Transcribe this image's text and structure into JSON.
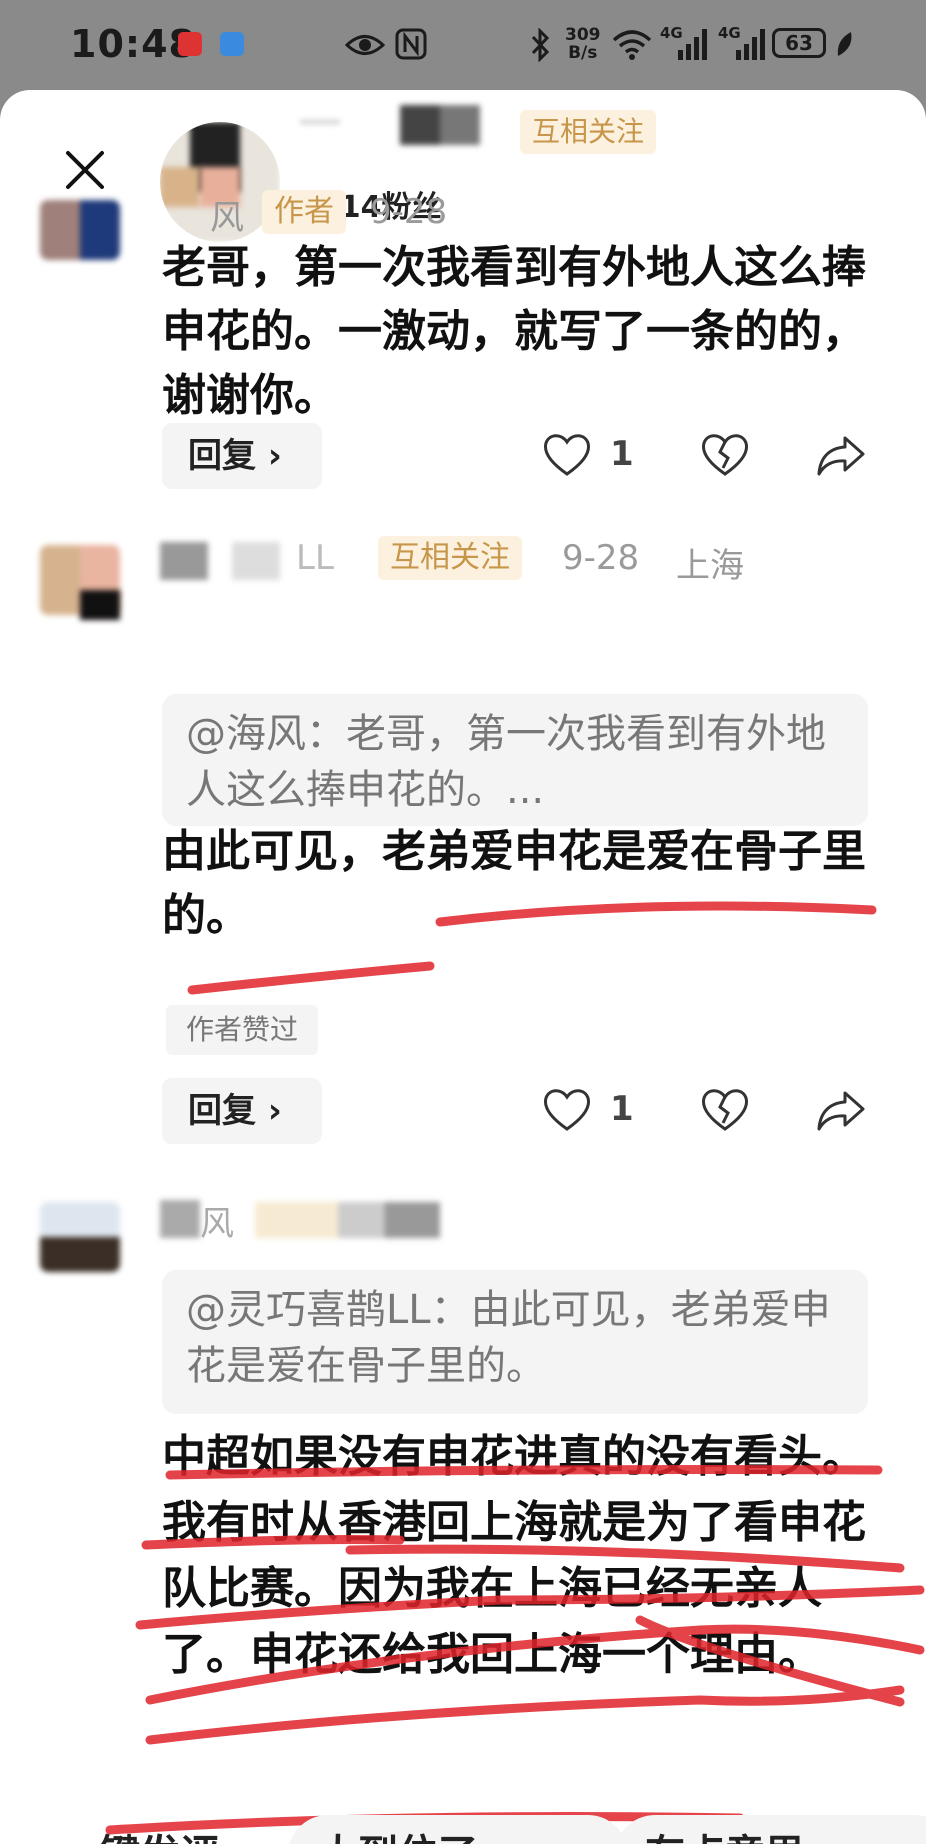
{
  "status_bar": {
    "time": "10:48",
    "net_speed_value": "309",
    "net_speed_unit": "B/s",
    "signal_1": "4G",
    "signal_2": "4G",
    "battery": "63"
  },
  "header": {
    "follow_tag": "互相关注",
    "followers": "1514粉丝"
  },
  "comments": [
    {
      "name_fragment": "风",
      "tag": "作者",
      "date": "9-28",
      "text": "老哥，第一次我看到有外地人这么捧申花的。一激动，就写了一条的的，谢谢你。",
      "reply_label": "回复",
      "likes": "1"
    },
    {
      "name_fragment": "LL",
      "tag": "互相关注",
      "date": "9-28",
      "location": "上海",
      "quote": "@海风：老哥，第一次我看到有外地人这么捧申花的。...",
      "text": "由此可见，老弟爱申花是爱在骨子里的。",
      "author_liked": "作者赞过",
      "reply_label": "回复",
      "likes": "1"
    },
    {
      "name_fragment": "风",
      "quote": "@灵巧喜鹊LL：由此可见，老弟爱申花是爱在骨子里的。",
      "text": "中超如果没有申花进真的没有看头。我有时从香港回上海就是为了看申花队比赛。因为我在上海已经无亲人了。申花还给我回上海一个理由。"
    }
  ],
  "bottom_chips": [
    "键发评",
    "太到位了",
    "有点意思"
  ],
  "colors": {
    "tag_bg": "#fbf1de",
    "tag_text": "#c8964a",
    "annotation_red": "#e0242a"
  }
}
